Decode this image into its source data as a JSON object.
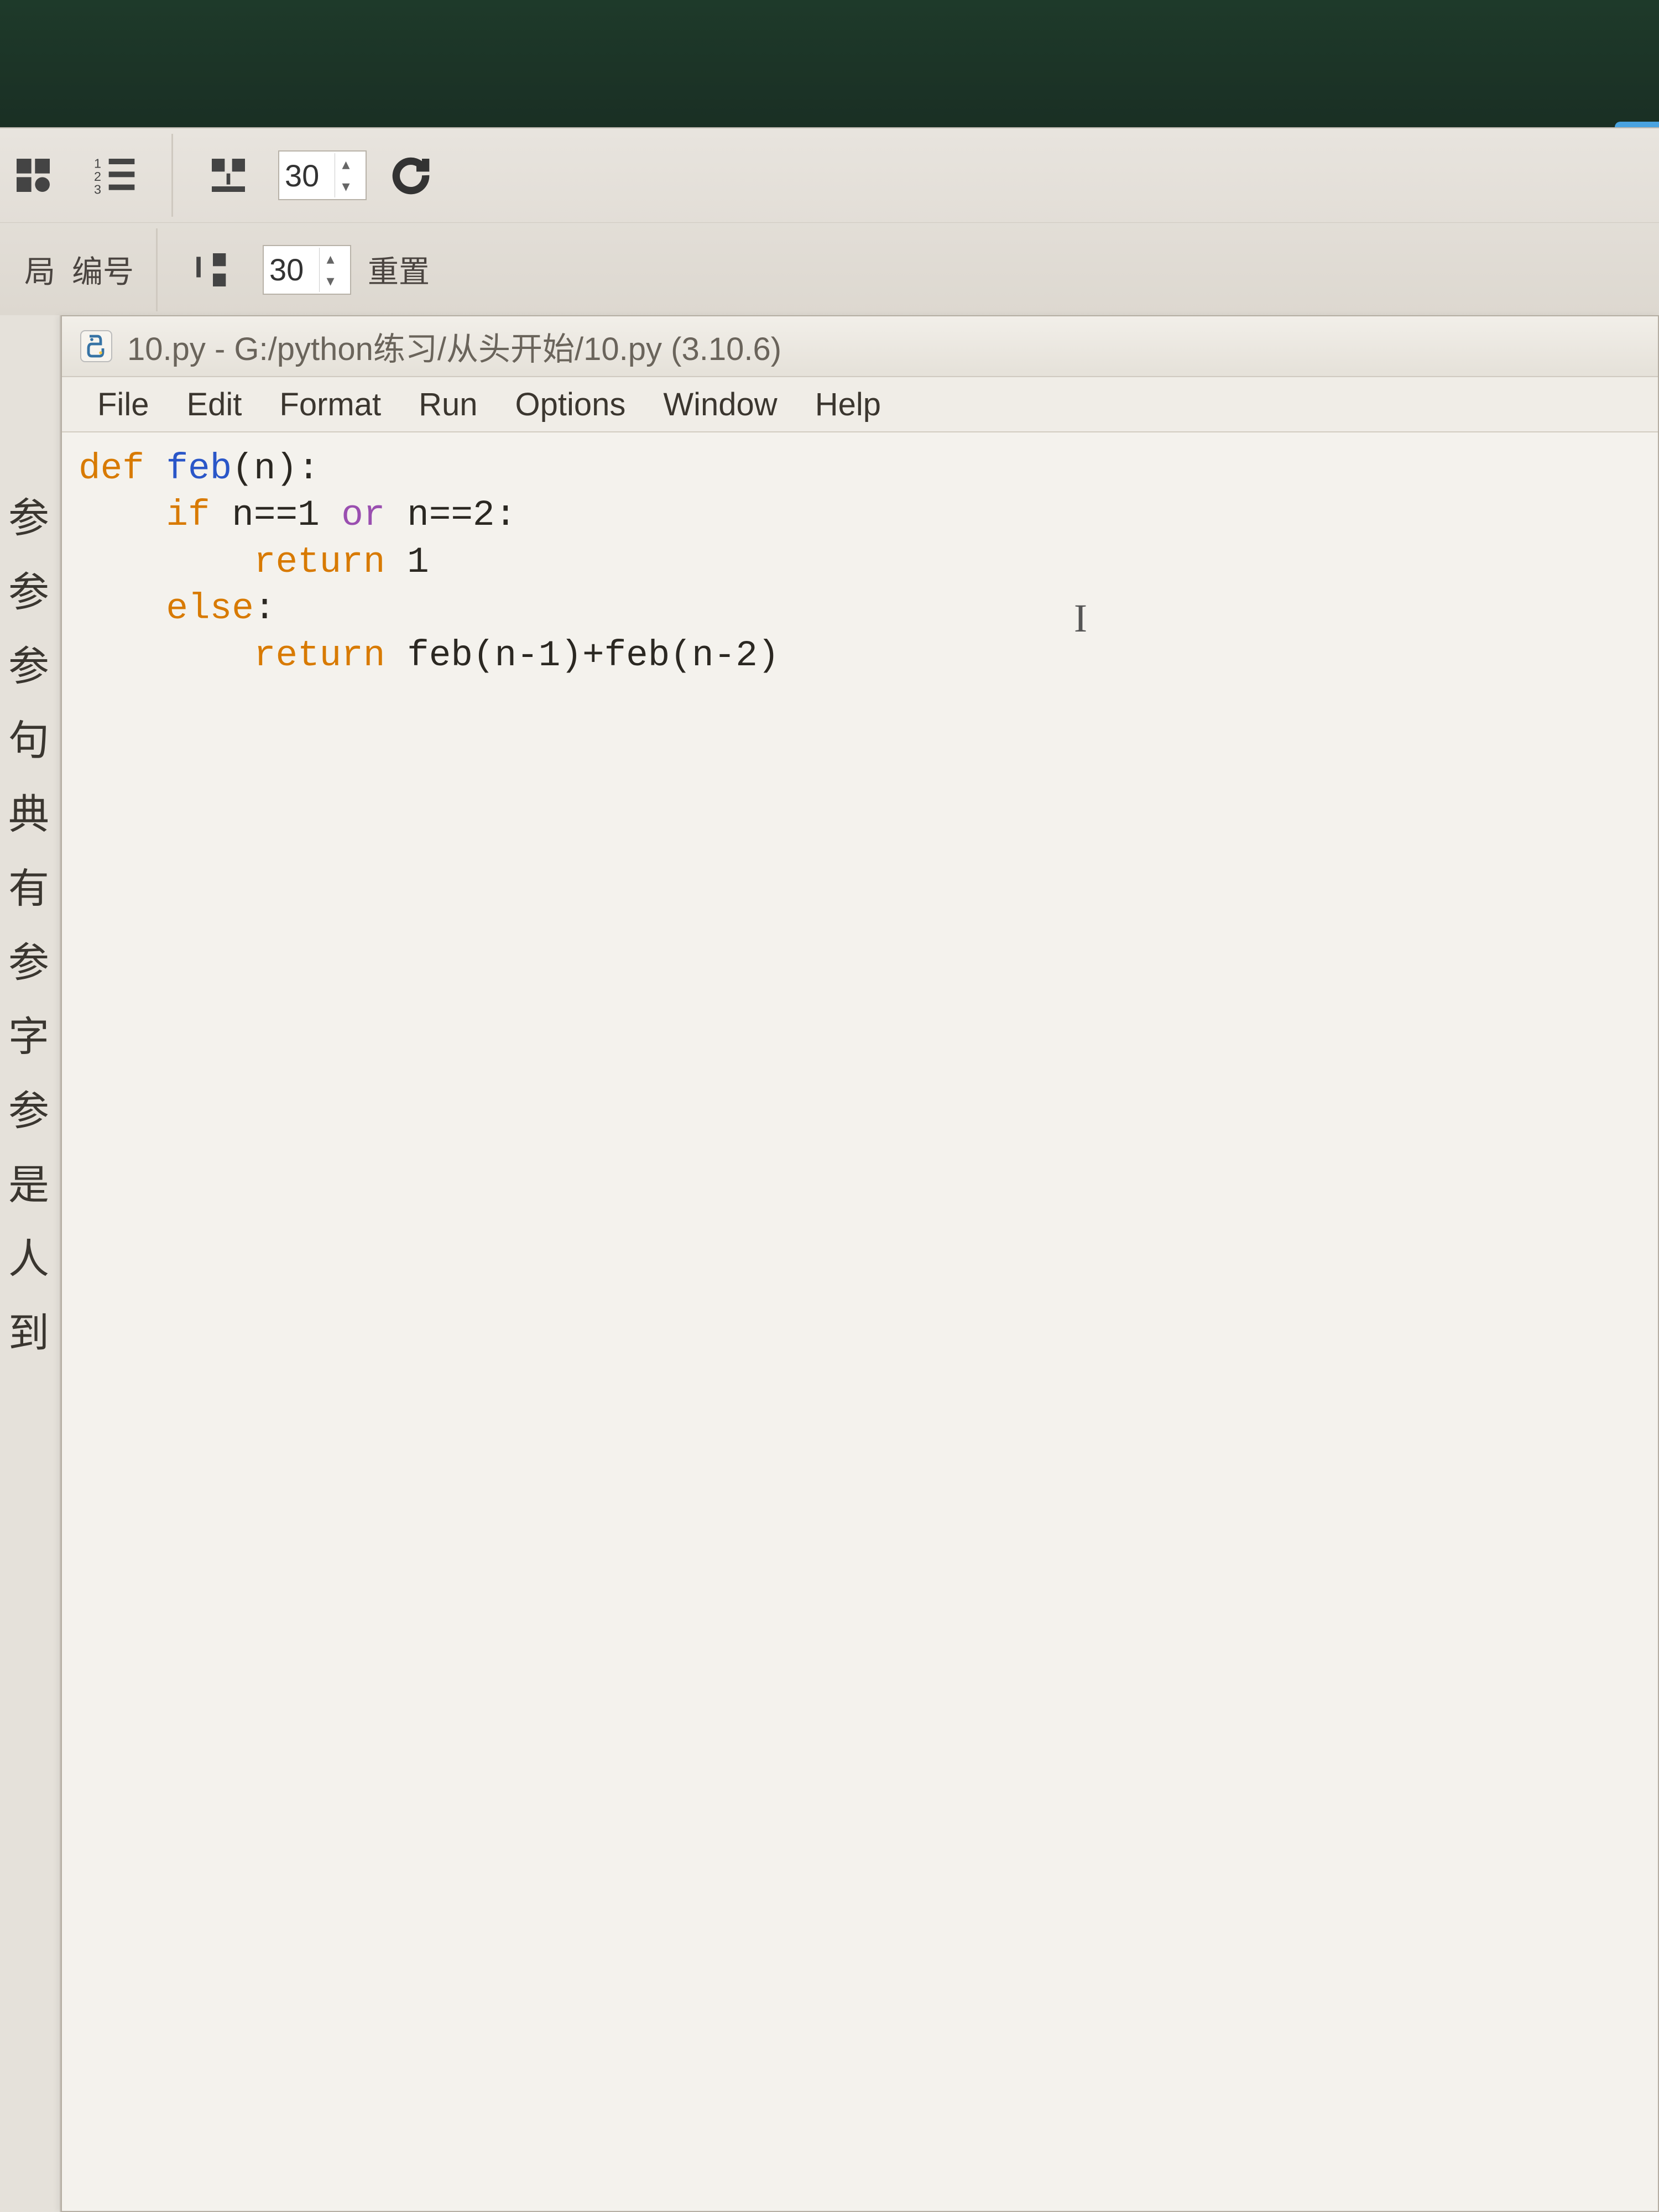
{
  "background_toolbar": {
    "row1": {
      "label_left": "局",
      "label_numbering": "编号",
      "spin_value": "30"
    },
    "row2": {
      "spin_value": "30",
      "reset_label": "重置"
    }
  },
  "left_strip_items": [
    "参",
    "参",
    "参",
    "句",
    "典",
    "有",
    "参",
    "字",
    "参",
    "是",
    "人",
    "到"
  ],
  "idle": {
    "title": "10.py - G:/python练习/从头开始/10.py (3.10.6)",
    "menus": [
      "File",
      "Edit",
      "Format",
      "Run",
      "Options",
      "Window",
      "Help"
    ],
    "code": {
      "l1_def": "def ",
      "l1_fn": "feb",
      "l1_rest": "(n):",
      "l2_if": "    if",
      "l2_a": " n==1 ",
      "l2_or": "or",
      "l2_b": " n==2:",
      "l3_ret": "        return",
      "l3_v": " 1",
      "l4_else": "    else",
      "l4_colon": ":",
      "l5_ret": "        return",
      "l5_expr": " feb(n-1)+feb(n-2)"
    },
    "caret_glyph": "I"
  }
}
